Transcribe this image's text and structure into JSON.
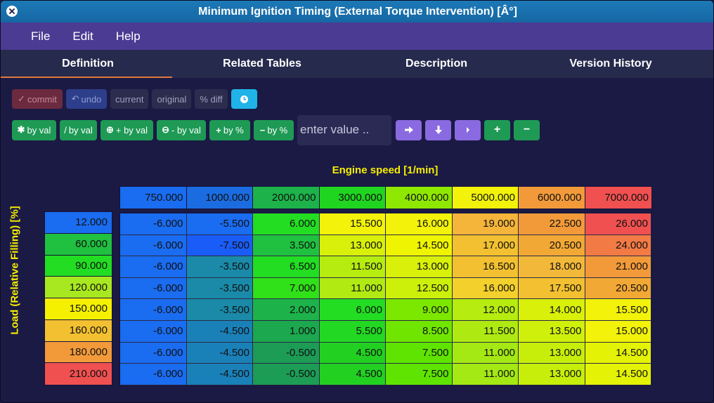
{
  "window": {
    "title": "Minimum Ignition Timing (External Torque Intervention) [Â°]"
  },
  "menu": [
    "File",
    "Edit",
    "Help"
  ],
  "tabs": [
    "Definition",
    "Related Tables",
    "Description",
    "Version History"
  ],
  "active_tab": "Definition",
  "toolbar": {
    "commit": "commit",
    "undo": "undo",
    "current": "current",
    "original": "original",
    "diff": "% diff"
  },
  "ops": [
    {
      "icon": "✱",
      "label": "by val"
    },
    {
      "icon": "/",
      "label": "by val"
    },
    {
      "icon": "⊕",
      "label": "+ by val"
    },
    {
      "icon": "⊖",
      "label": "- by val"
    },
    {
      "icon": "+",
      "label": "by %"
    },
    {
      "icon": "−",
      "label": "by %"
    }
  ],
  "value_input": {
    "placeholder": "enter value .."
  },
  "nav_buttons": [
    "arrow-right-icon",
    "arrow-down-icon",
    "small-arrow-right-icon"
  ],
  "plus_label": "+",
  "minus_label": "−",
  "x_axis": {
    "label": "Engine speed [1/min]",
    "values": [
      "750.000",
      "1000.000",
      "2000.000",
      "3000.000",
      "4000.000",
      "5000.000",
      "6000.000",
      "7000.000"
    ],
    "colors": [
      "#1a6cf0",
      "#1b6ce0",
      "#1db34a",
      "#20d520",
      "#8fe800",
      "#f2f20a",
      "#f29a3a",
      "#f05050"
    ]
  },
  "y_axis": {
    "label": "Load (Relative Filling) [%]",
    "values": [
      "12.000",
      "60.000",
      "90.000",
      "120.000",
      "150.000",
      "160.000",
      "180.000",
      "210.000"
    ],
    "colors": [
      "#1a6cf0",
      "#20c040",
      "#22dd22",
      "#a8e820",
      "#f4f000",
      "#f2c030",
      "#f29a3a",
      "#f05050"
    ]
  },
  "table": {
    "rows": [
      [
        "-6.000",
        "-5.500",
        "6.000",
        "15.500",
        "16.000",
        "19.000",
        "22.500",
        "26.000"
      ],
      [
        "-6.000",
        "-7.500",
        "3.500",
        "13.000",
        "14.500",
        "17.000",
        "20.500",
        "24.000"
      ],
      [
        "-6.000",
        "-3.500",
        "6.500",
        "11.500",
        "13.000",
        "16.500",
        "18.000",
        "21.000"
      ],
      [
        "-6.000",
        "-3.500",
        "7.000",
        "11.000",
        "12.500",
        "16.000",
        "17.500",
        "20.500"
      ],
      [
        "-6.000",
        "-3.500",
        "2.000",
        "6.000",
        "9.000",
        "12.000",
        "14.000",
        "15.500"
      ],
      [
        "-6.000",
        "-4.500",
        "1.000",
        "5.500",
        "8.500",
        "11.500",
        "13.500",
        "15.000"
      ],
      [
        "-6.000",
        "-4.500",
        "-0.500",
        "4.500",
        "7.500",
        "11.000",
        "13.000",
        "14.500"
      ],
      [
        "-6.000",
        "-4.500",
        "-0.500",
        "4.500",
        "7.500",
        "11.000",
        "13.000",
        "14.500"
      ]
    ],
    "colors": [
      [
        "#1a6cf0",
        "#1a6cf0",
        "#22dd22",
        "#f2f20a",
        "#f2f20a",
        "#f5b43a",
        "#f29a3a",
        "#f05050"
      ],
      [
        "#1a6cf0",
        "#1a5cf8",
        "#20c040",
        "#d8f00a",
        "#eff500",
        "#f2c030",
        "#f2a835",
        "#f27a45"
      ],
      [
        "#1a6cf0",
        "#1a8aa8",
        "#22dd22",
        "#b6ec10",
        "#d8f00a",
        "#f2c030",
        "#f2b83a",
        "#f29a3a"
      ],
      [
        "#1a6cf0",
        "#1a8aa8",
        "#30e018",
        "#b0ea12",
        "#cdf00a",
        "#f4d02c",
        "#f2c030",
        "#f2a835"
      ],
      [
        "#1a6cf0",
        "#1a8aa8",
        "#1db34a",
        "#22dd22",
        "#7ce800",
        "#b6ec10",
        "#d8f00a",
        "#f2f20a"
      ],
      [
        "#1a6cf0",
        "#1a80b8",
        "#1ca84e",
        "#22d822",
        "#70e600",
        "#aeea12",
        "#cff00a",
        "#f2f20a"
      ],
      [
        "#1a6cf0",
        "#1a80b8",
        "#1c9c55",
        "#22d022",
        "#5ee400",
        "#a4e814",
        "#c6ee0a",
        "#e4f205"
      ],
      [
        "#1a6cf0",
        "#1a80b8",
        "#1c9c55",
        "#22d022",
        "#5ee400",
        "#a4e814",
        "#c6ee0a",
        "#e4f205"
      ]
    ]
  },
  "colors": {
    "titlebar": "#1c79b7",
    "menubar": "#4b3b93",
    "background": "#1b1a44",
    "axis_label": "#f6ee00",
    "tab_accent": "#e07a3e"
  }
}
